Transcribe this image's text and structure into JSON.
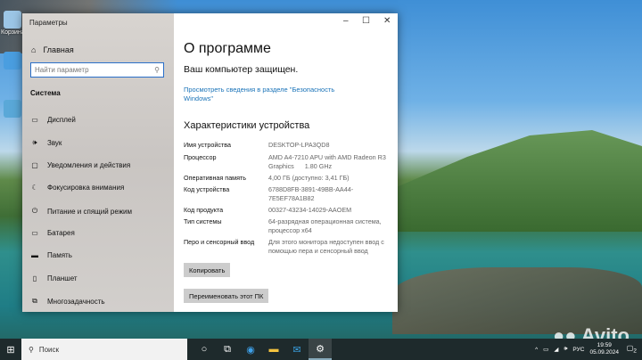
{
  "window": {
    "title": "Параметры",
    "minimize": "–",
    "maximize": "☐",
    "close": "✕"
  },
  "desktop": {
    "icons": [
      {
        "label": "Корзина"
      }
    ]
  },
  "sidebar": {
    "home": "Главная",
    "search_placeholder": "Найти параметр",
    "section": "Система",
    "items": [
      {
        "label": "Дисплей",
        "icon": "display-icon"
      },
      {
        "label": "Звук",
        "icon": "sound-icon"
      },
      {
        "label": "Уведомления и действия",
        "icon": "notifications-icon"
      },
      {
        "label": "Фокусировка внимания",
        "icon": "focus-icon"
      },
      {
        "label": "Питание и спящий режим",
        "icon": "power-icon"
      },
      {
        "label": "Батарея",
        "icon": "battery-icon"
      },
      {
        "label": "Память",
        "icon": "storage-icon"
      },
      {
        "label": "Планшет",
        "icon": "tablet-icon"
      },
      {
        "label": "Многозадачность",
        "icon": "multitasking-icon"
      }
    ]
  },
  "main": {
    "title": "О программе",
    "protected": "Ваш компьютер защищен.",
    "security_link": "Просмотреть сведения в разделе \"Безопасность Windows\"",
    "specs_title": "Характеристики устройства",
    "specs": [
      {
        "k": "Имя устройства",
        "v": "DESKTOP-LPA3QD8"
      },
      {
        "k": "Процессор",
        "v": "AMD A4-7210 APU with AMD Radeon R3 Graphics      1.80 GHz"
      },
      {
        "k": "Оперативная память",
        "v": "4,00 ГБ (доступно: 3,41 ГБ)"
      },
      {
        "k": "Код устройства",
        "v": "6788D8FB-3891-49BB-AA44-7E5EF78A1B82"
      },
      {
        "k": "Код продукта",
        "v": "00327-43234-14029-AAOEM"
      },
      {
        "k": "Тип системы",
        "v": "64-разрядная операционная система, процессор x64"
      },
      {
        "k": "Перо и сенсорный ввод",
        "v": "Для этого монитора недоступен ввод с помощью пера и сенсорный ввод"
      }
    ],
    "copy": "Копировать",
    "rename": "Переименовать этот ПК"
  },
  "taskbar": {
    "search": "Поиск",
    "lang": "РУС",
    "time": "19:59",
    "date": "05.09.2024",
    "notif_count": "2"
  },
  "watermark": "Avito"
}
